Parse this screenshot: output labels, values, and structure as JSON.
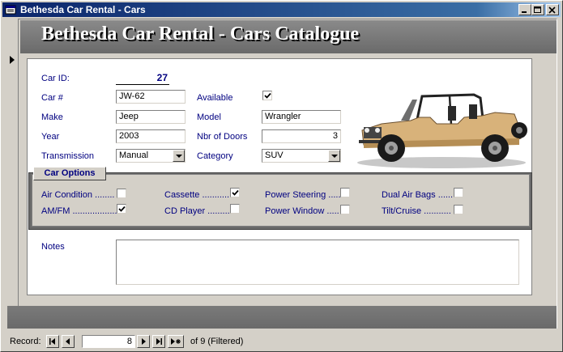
{
  "window": {
    "title": "Bethesda Car Rental - Cars",
    "app_icon": "form-icon",
    "controls": [
      "minimize-icon",
      "maximize-icon",
      "close-icon"
    ]
  },
  "header": {
    "title": "Bethesda Car Rental - Cars Catalogue"
  },
  "fields": {
    "car_id_label": "Car ID:",
    "car_id": "27",
    "car_number_label": "Car #",
    "car_number": "JW-62",
    "make_label": "Make",
    "make": "Jeep",
    "year_label": "Year",
    "year": "2003",
    "transmission_label": "Transmission",
    "transmission": "Manual",
    "available_label": "Available",
    "available": true,
    "model_label": "Model",
    "model": "Wrangler",
    "doors_label": "Nbr of Doors",
    "doors": "3",
    "category_label": "Category",
    "category": "SUV",
    "notes_label": "Notes",
    "notes": ""
  },
  "options": {
    "title": "Car Options",
    "items": [
      {
        "label": "Air Condition ........",
        "checked": false
      },
      {
        "label": "AM/FM ..................",
        "checked": true
      },
      {
        "label": "Cassette ...........",
        "checked": true
      },
      {
        "label": "CD Player .........",
        "checked": false
      },
      {
        "label": "Power Steering .....",
        "checked": false
      },
      {
        "label": "Power Window .....",
        "checked": false
      },
      {
        "label": "Dual Air Bags ......",
        "checked": false
      },
      {
        "label": "Tilt/Cruise ...........",
        "checked": false
      }
    ]
  },
  "image": {
    "icon": "jeep-image"
  },
  "navigation": {
    "record_label": "Record:",
    "current_record": "8",
    "of_text": "of  9 (Filtered)",
    "buttons": [
      "first-record-icon",
      "previous-record-icon",
      "next-record-icon",
      "last-record-icon",
      "new-record-icon"
    ]
  }
}
